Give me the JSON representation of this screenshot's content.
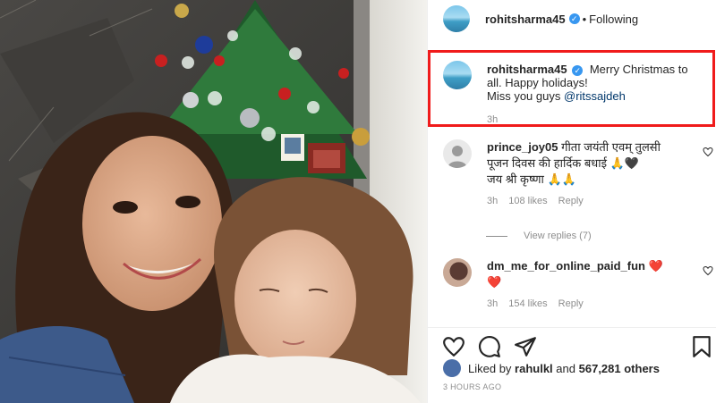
{
  "post": {
    "author": "rohitsharma45",
    "follow_status": "Following",
    "separator": "•"
  },
  "caption": {
    "username": "rohitsharma45",
    "text_line1": "Merry Christmas to all. Happy holidays!",
    "text_line2": "Miss you guys",
    "mention": "@ritssajdeh",
    "time": "3h"
  },
  "comments": [
    {
      "username": "prince_joy05",
      "text": "गीता जयंती एवम् तुलसी पूजन दिवस की हार्दिक बधाई 🙏🖤",
      "text2": "जय श्री कृष्णा 🙏🙏",
      "time": "3h",
      "likes": "108 likes",
      "reply": "Reply"
    },
    {
      "username": "dm_me_for_online_paid_fun",
      "text": "❤️ ❤️",
      "time": "3h",
      "likes": "154 likes",
      "reply": "Reply"
    }
  ],
  "view_replies": "View replies (7)",
  "likes": {
    "prefix": "Liked by",
    "user": "rahulkl",
    "conj": "and",
    "count": "567,281 others"
  },
  "posted_ago": "3 HOURS AGO",
  "icons": {
    "like": "heart-outline-icon",
    "comment": "speech-bubble-icon",
    "share": "paper-plane-icon",
    "save": "bookmark-icon"
  },
  "colors": {
    "verified": "#3897f0",
    "highlight": "#f01b1b",
    "heart_red": "#ed4956",
    "link": "#00376b"
  }
}
